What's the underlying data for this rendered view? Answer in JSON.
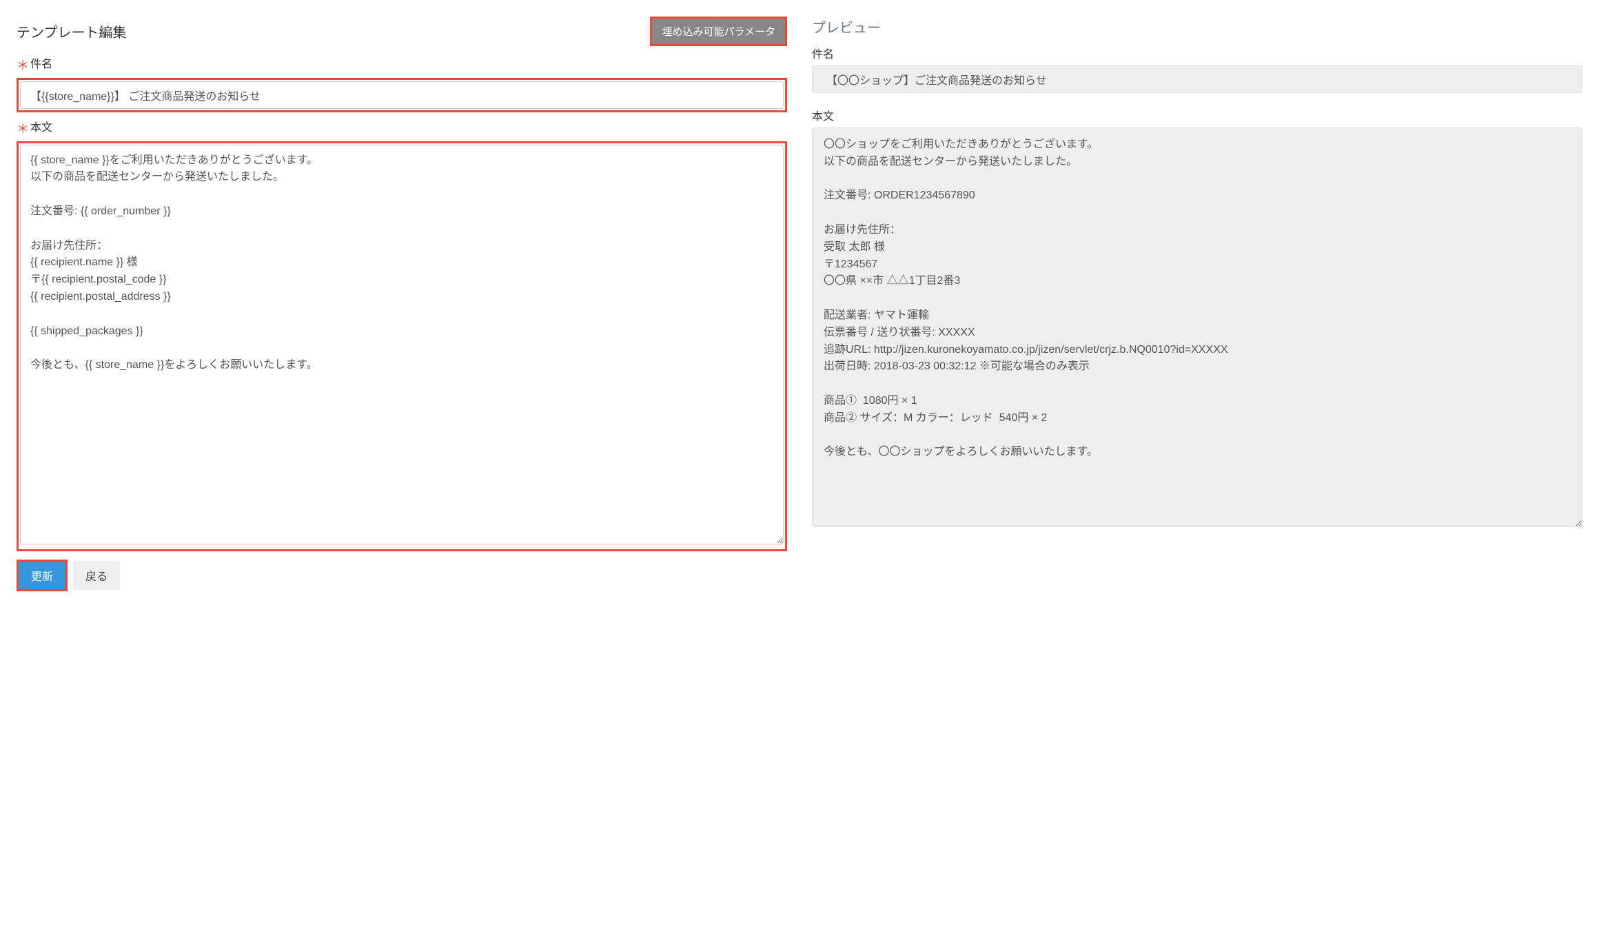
{
  "editor": {
    "title": "テンプレート編集",
    "param_button_label": "埋め込み可能パラメータ",
    "subject_label": "件名",
    "subject_value": "【{{store_name}}】 ご注文商品発送のお知らせ",
    "body_label": "本文",
    "body_value": "{{ store_name }}をご利用いただきありがとうございます。\n以下の商品を配送センターから発送いたしました。\n\n注文番号: {{ order_number }}\n\nお届け先住所：\n{{ recipient.name }} 様\n〒{{ recipient.postal_code }}\n{{ recipient.postal_address }}\n\n{{ shipped_packages }}\n\n今後とも、{{ store_name }}をよろしくお願いいたします。",
    "update_button_label": "更新",
    "back_button_label": "戻る",
    "required_mark": "＊"
  },
  "preview": {
    "title": "プレビュー",
    "subject_label": "件名",
    "subject_value": "【〇〇ショップ】ご注文商品発送のお知らせ",
    "body_label": "本文",
    "body_value": "〇〇ショップをご利用いただきありがとうございます。\n以下の商品を配送センターから発送いたしました。\n\n注文番号: ORDER1234567890\n\nお届け先住所：\n受取 太郎 様\n〒1234567\n〇〇県 ××市 △△1丁目2番3\n\n配送業者: ヤマト運輸\n伝票番号 / 送り状番号: XXXXX\n追跡URL: http://jizen.kuronekoyamato.co.jp/jizen/servlet/crjz.b.NQ0010?id=XXXXX\n出荷日時: 2018-03-23 00:32:12 ※可能な場合のみ表示\n\n商品①  1080円 × 1\n商品② サイズ：M カラー：レッド  540円 × 2\n\n今後とも、〇〇ショップをよろしくお願いいたします。"
  }
}
